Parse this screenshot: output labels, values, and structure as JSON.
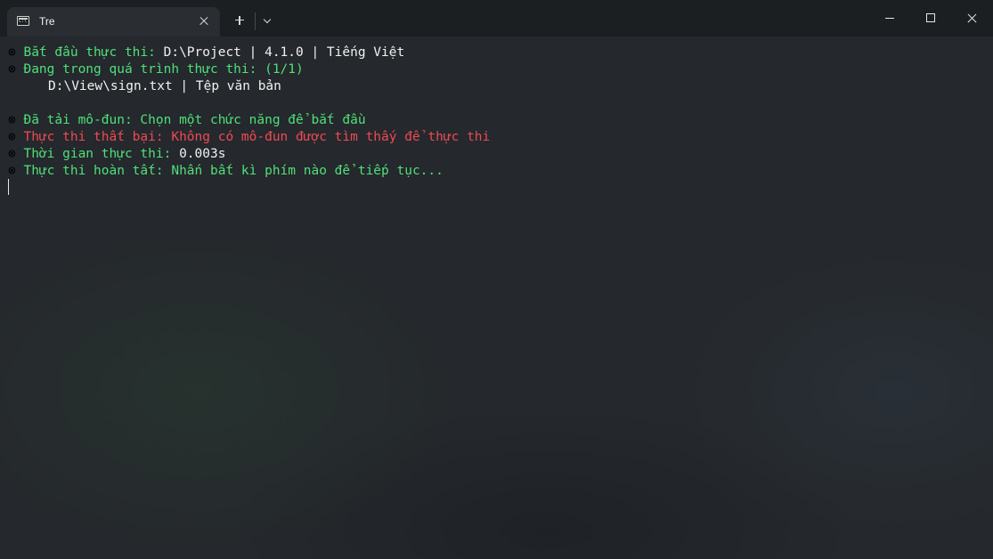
{
  "tab": {
    "title": "Tre",
    "icon": "terminal-icon",
    "icon_text": "C:\\"
  },
  "colors": {
    "success": "#4ee07a",
    "error": "#ee4a55",
    "text": "#f1f1f1",
    "background": "#25282c",
    "titlebar": "#1c1f22"
  },
  "terminal": {
    "bullet": "⊗",
    "lines": {
      "start_label": "Bắt đầu thực thi: ",
      "start_value": "D:\\Project | 4.1.0 | Tiếng Việt",
      "progress_label": "Đang trong quá trình thực thi: (1/1)",
      "file_line": "D:\\View\\sign.txt | Tệp văn bản",
      "loaded_label": "Đã tải mô-đun: Chọn một chức năng để bắt đầu",
      "failed_label": "Thực thi thất bại: Không có mô-đun được tìm thấy để thực thi",
      "time_label": "Thời gian thực thi: ",
      "time_value": "0.003s",
      "done_label": "Thực thi hoàn tất: Nhấn bất kì phím nào để tiếp tục..."
    }
  }
}
